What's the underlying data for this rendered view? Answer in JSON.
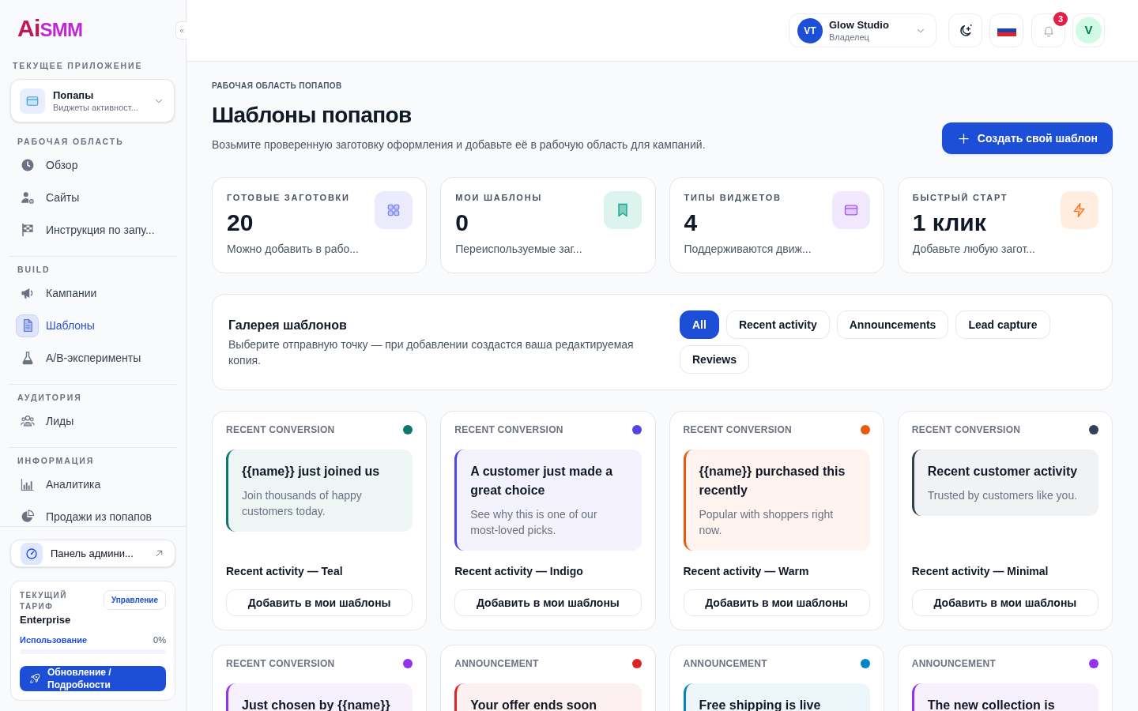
{
  "sidebar": {
    "logo": {
      "prefix": "Ai",
      "name": "SMM"
    },
    "current_app": {
      "heading": "ТЕКУЩЕЕ ПРИЛОЖЕНИЕ",
      "title": "Попапы",
      "subtitle": "Виджеты активност..."
    },
    "sections": [
      {
        "heading": "РАБОЧАЯ ОБЛАСТЬ",
        "items": [
          {
            "label": "Обзор",
            "selected": false
          },
          {
            "label": "Сайты",
            "selected": false
          },
          {
            "label": "Инструкция по запу...",
            "selected": false
          }
        ]
      },
      {
        "heading": "BUILD",
        "items": [
          {
            "label": "Кампании",
            "selected": false
          },
          {
            "label": "Шаблоны",
            "selected": true
          },
          {
            "label": "A/B‑эксперименты",
            "selected": false
          }
        ]
      },
      {
        "heading": "АУДИТОРИЯ",
        "items": [
          {
            "label": "Лиды",
            "selected": false
          }
        ]
      },
      {
        "heading": "ИНФОРМАЦИЯ",
        "items": [
          {
            "label": "Аналитика",
            "selected": false
          },
          {
            "label": "Продажи из попапов",
            "selected": false
          }
        ]
      }
    ],
    "admin_link": {
      "label": "Панель админи..."
    },
    "plan": {
      "heading": "ТЕКУЩИЙ ТАРИФ",
      "manage_button": "Управление",
      "name": "Enterprise",
      "usage_label": "Использование",
      "usage_value": "0%",
      "usage": {
        "level": 0
      },
      "upgrade_button": "Обновление / Подробности"
    }
  },
  "top_bar": {
    "account": {
      "initials": "VT",
      "name": "Glow Studio",
      "role": "Владелец"
    },
    "notifications": {
      "count": "3"
    },
    "user": {
      "initial": "V"
    }
  },
  "page": {
    "breadcrumb": "РАБОЧАЯ ОБЛАСТЬ ПОПАПОВ",
    "title": "Шаблоны попапов",
    "subtitle": "Возьмите проверенную заготовку оформления и добавьте её в рабочую область для кампаний.",
    "create_button": "Создать свой шаблон"
  },
  "stats": [
    {
      "label": "ГОТОВЫЕ ЗАГОТОВКИ",
      "value": "20",
      "caption": "Можно добавить в рабо..."
    },
    {
      "label": "МОИ ШАБЛОНЫ",
      "value": "0",
      "caption": "Переиспользуемые заг..."
    },
    {
      "label": "ТИПЫ ВИДЖЕТОВ",
      "value": "4",
      "caption": "Поддерживаются движ..."
    },
    {
      "label": "БЫСТРЫЙ СТАРТ",
      "value": "1 клик",
      "caption": "Добавьте любую загот..."
    }
  ],
  "gallery": {
    "title": "Галерея шаблонов",
    "description": "Выберите отправную точку — при добавлении создастся ваша редактируемая копия.",
    "filters": [
      {
        "label": "All",
        "selected": true
      },
      {
        "label": "Recent activity",
        "selected": false
      },
      {
        "label": "Announcements",
        "selected": false
      },
      {
        "label": "Lead capture",
        "selected": false
      },
      {
        "label": "Reviews",
        "selected": false
      }
    ]
  },
  "templates": [
    {
      "category": "RECENT CONVERSION",
      "color": "#0f766e",
      "preview_title": "{{name}} just joined us",
      "preview_text": "Join thousands of happy customers today.",
      "name": "Recent activity — Teal",
      "button": "Добавить в мои шаблоны"
    },
    {
      "category": "RECENT CONVERSION",
      "color": "#4f46e5",
      "preview_title": "A customer just made a great choice",
      "preview_text": "See why this is one of our most‑loved picks.",
      "name": "Recent activity — Indigo",
      "button": "Добавить в мои шаблоны"
    },
    {
      "category": "RECENT CONVERSION",
      "color": "#ea580c",
      "preview_title": "{{name}} purchased this recently",
      "preview_text": "Popular with shoppers right now.",
      "name": "Recent activity — Warm",
      "button": "Добавить в мои шаблоны"
    },
    {
      "category": "RECENT CONVERSION",
      "color": "#334155",
      "preview_title": "Recent customer activity",
      "preview_text": "Trusted by customers like you.",
      "name": "Recent activity — Minimal",
      "button": "Добавить в мои шаблоны"
    },
    {
      "category": "RECENT CONVERSION",
      "color": "#9333ea",
      "preview_title": "Just chosen by {{name}}"
    },
    {
      "category": "ANNOUNCEMENT",
      "color": "#dc2626",
      "preview_title": "Your offer ends soon"
    },
    {
      "category": "ANNOUNCEMENT",
      "color": "#0284c7",
      "preview_title": "Free shipping is live"
    },
    {
      "category": "ANNOUNCEMENT",
      "color": "#9333ea",
      "preview_title": "The new collection is"
    }
  ]
}
